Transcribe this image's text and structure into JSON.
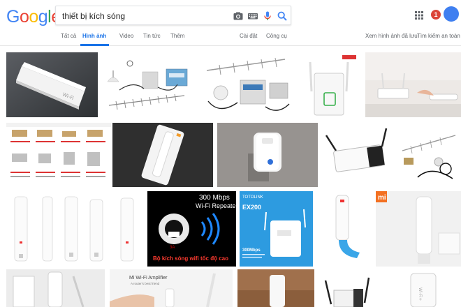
{
  "logo": {
    "letters": [
      "G",
      "o",
      "o",
      "g",
      "l",
      "e"
    ],
    "colors": [
      "#4285F4",
      "#EA4335",
      "#FBBC05",
      "#4285F4",
      "#34A853",
      "#EA4335"
    ]
  },
  "search": {
    "query": "thiết bị kích sóng"
  },
  "header": {
    "notification_count": "1"
  },
  "tabs": {
    "all": "Tất cả",
    "images": "Hình ảnh",
    "videos": "Video",
    "news": "Tin tức",
    "more": "Thêm",
    "settings": "Cài đặt",
    "tools": "Công cụ",
    "saved": "Xem hình ảnh đã lưu",
    "safesearch": "Tìm kiếm an toàn"
  },
  "results": {
    "tile_texts": {
      "repeater_headline": "300 Mbps",
      "repeater_sub": "Wi-Fi Repeater",
      "repeater_caption": "Bộ kích sóng wifi tốc độ cao",
      "ex200_brand": "TOTOLINK",
      "ex200_model": "EX200",
      "ex200_speed": "300Mbps",
      "mi_amp_title": "Mi Wi-Fi Amplifier",
      "mi_amp_sub": "A router's best friend",
      "mi_logo": "mi"
    }
  },
  "colors": {
    "accent": "#1a73e8",
    "badge": "#db4437"
  }
}
